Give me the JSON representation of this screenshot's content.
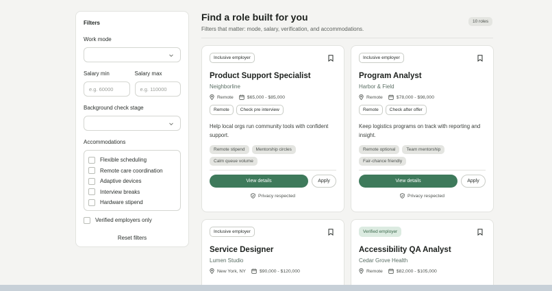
{
  "sidebar": {
    "title": "Filters",
    "work_mode_label": "Work mode",
    "salary_min_label": "Salary min",
    "salary_min_placeholder": "e.g. 60000",
    "salary_max_label": "Salary max",
    "salary_max_placeholder": "e.g. 110000",
    "background_label": "Background check stage",
    "accommodations_label": "Accommodations",
    "accommodations": [
      "Flexible scheduling",
      "Remote care coordination",
      "Adaptive devices",
      "Interview breaks",
      "Hardware stipend"
    ],
    "verified_only": "Verified employers only",
    "reset": "Reset filters"
  },
  "header": {
    "title": "Find a role built for you",
    "subtitle": "Filters that matter: mode, salary, verification, and accommodations.",
    "count": "10 roles"
  },
  "cards": [
    {
      "tag": "Inclusive employer",
      "role": "Product Support Specialist",
      "company": "Neighborline",
      "location": "Remote",
      "salary": "$65,000 - $85,000",
      "pills": [
        "Remote",
        "Check pre interview"
      ],
      "description": "Help local orgs run community tools with confident support.",
      "chips": [
        "Remote stipend",
        "Mentorship circles",
        "Calm queue volume"
      ],
      "primary": "View details",
      "apply": "Apply",
      "privacy": "Privacy respected"
    },
    {
      "tag": "Inclusive employer",
      "role": "Program Analyst",
      "company": "Harbor & Field",
      "location": "Remote",
      "salary": "$78,000 - $98,000",
      "pills": [
        "Remote",
        "Check after offer"
      ],
      "description": "Keep logistics programs on track with reporting and insight.",
      "chips": [
        "Remote optional",
        "Team mentorship",
        "Fair-chance friendly"
      ],
      "primary": "View details",
      "apply": "Apply",
      "privacy": "Privacy respected"
    },
    {
      "tag": "Inclusive employer",
      "role": "Service Designer",
      "company": "Lumen Studio",
      "location": "New York, NY",
      "salary": "$90,000 - $120,000"
    },
    {
      "tag": "Verified employer",
      "role": "Accessibility QA Analyst",
      "company": "Cedar Grove Health",
      "location": "Remote",
      "salary": "$82,000 - $105,000"
    }
  ],
  "colors": {
    "accent": "#3e7a5b",
    "verified_bg": "#dcebe1"
  }
}
